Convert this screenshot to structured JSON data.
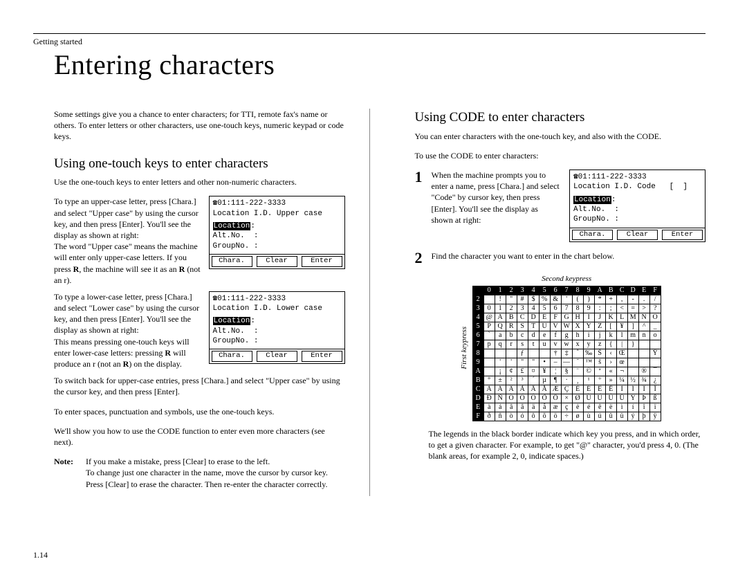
{
  "breadcrumb": "Getting started",
  "title": "Entering characters",
  "intro": "Some settings give you a chance to enter characters; for TTI, remote fax's name or others. To enter letters or other characters, use one-touch keys, numeric keypad or code keys.",
  "left": {
    "heading": "Using one-touch keys to enter characters",
    "p1": "Use the one-touch keys to enter letters and other non-numeric characters.",
    "p2": "To type an upper-case letter, press [Chara.] and select \"Upper case\" by using the cursor key, and then press [Enter]. You'll see the display as shown at right:",
    "p3a": "The word \"Upper case\" means the machine will enter only upper-case letters. If you press ",
    "p3b": "R",
    "p3c": ", the machine will see it as an ",
    "p3d": "R",
    "p3e": " (not an r).",
    "p4": "To type a lower-case letter, press [Chara.] and select \"Lower case\" by using the cursor key, and then press [Enter]. You'll see the display as shown at right:",
    "p5a": "This means pressing one-touch keys will enter lower-case letters: pressing ",
    "p5b": "R",
    "p5c": " will produce an r (not an ",
    "p5d": "R",
    "p5e": ") on the display.",
    "p6": "To switch back for upper-case entries, press [Chara.] and select \"Upper case\" by using the cursor key, and then press [Enter].",
    "p7": "To enter spaces, punctuation and symbols, use the one-touch keys.",
    "p8a": "We'll show you how to use the ",
    "p8b": "CODE",
    "p8c": " function to enter even more characters (see next).",
    "note_label": "Note:",
    "note_body": "If you make a mistake, press [Clear] to erase to the left.\nTo change just one character in the name, move the cursor by cursor key. Press [Clear] to erase the character. Then re-enter the character correctly."
  },
  "right": {
    "heading_a": "Using ",
    "heading_b": "CODE",
    "heading_c": " to enter characters",
    "p1a": "You can enter characters with the one-touch key, and also with the ",
    "p1b": "CODE",
    "p1c": ".",
    "p2a": "To use the ",
    "p2b": "CODE",
    "p2c": " to enter characters:",
    "step1": "When the machine prompts you to enter a name, press [Chara.] and select \"Code\" by cursor key, then press [Enter]. You'll see the display as shown at right:",
    "step2": "Find the character you want to enter in the chart below.",
    "chart_h": "Second keypress",
    "chart_v": "First keypress",
    "legend": "The legends in the black border indicate which key you press, and in which order, to get a given character. For example, to get \"@\" character, you'd press 4, 0. (The blank areas, for example 2, 0, indicate spaces.)"
  },
  "lcd": {
    "upper": {
      "l1": "☎01:111-222-3333",
      "l2": "Location I.D. Upper case",
      "l3_pre": "Location",
      "l3_post": ":",
      "l4": "Alt.No.  :",
      "l5": "GroupNo. :",
      "b1": "Chara.",
      "b2": "Clear",
      "b3": "Enter"
    },
    "lower": {
      "l1": "☎01:111-222-3333",
      "l2": "Location I.D. Lower case",
      "l3_pre": "Location",
      "l3_post": ":",
      "l4": "Alt.No.  :",
      "l5": "GroupNo. :",
      "b1": "Chara.",
      "b2": "Clear",
      "b3": "Enter"
    },
    "code": {
      "l1": "☎01:111-222-3333",
      "l2": "Location I.D. Code   [  ]",
      "l3_pre": "Location",
      "l3_post": ":",
      "l4": "Alt.No.  :",
      "l5": "GroupNo. :",
      "b1": "Chara.",
      "b2": "Clear",
      "b3": "Enter"
    }
  },
  "chart_data": {
    "type": "table",
    "col_headers": [
      "0",
      "1",
      "2",
      "3",
      "4",
      "5",
      "6",
      "7",
      "8",
      "9",
      "A",
      "B",
      "C",
      "D",
      "E",
      "F"
    ],
    "row_headers": [
      "2",
      "3",
      "4",
      "5",
      "6",
      "7",
      "8",
      "9",
      "A",
      "B",
      "C",
      "D",
      "E",
      "F"
    ],
    "rows": [
      [
        "",
        "!",
        "\"",
        "#",
        "$",
        "%",
        "&",
        "'",
        "(",
        ")",
        "*",
        "+",
        ",",
        "-",
        ".",
        "/"
      ],
      [
        "0",
        "1",
        "2",
        "3",
        "4",
        "5",
        "6",
        "7",
        "8",
        "9",
        ":",
        ";",
        "<",
        "=",
        ">",
        "?"
      ],
      [
        "@",
        "A",
        "B",
        "C",
        "D",
        "E",
        "F",
        "G",
        "H",
        "I",
        "J",
        "K",
        "L",
        "M",
        "N",
        "O"
      ],
      [
        "P",
        "Q",
        "R",
        "S",
        "T",
        "U",
        "V",
        "W",
        "X",
        "Y",
        "Z",
        "[",
        "¥",
        "]",
        "^",
        "_"
      ],
      [
        "`",
        "a",
        "b",
        "c",
        "d",
        "e",
        "f",
        "g",
        "h",
        "i",
        "j",
        "k",
        "l",
        "m",
        "n",
        "o"
      ],
      [
        "p",
        "q",
        "r",
        "s",
        "t",
        "u",
        "v",
        "w",
        "x",
        "y",
        "z",
        "{",
        "|",
        "}",
        "‾",
        ""
      ],
      [
        "",
        "",
        "",
        "ƒ",
        "",
        "",
        "†",
        "‡",
        "ˆ",
        "‰",
        "Š",
        "‹",
        "Œ",
        "",
        "",
        "Ÿ"
      ],
      [
        "",
        "'",
        "'",
        "\"",
        "\"",
        "•",
        "–",
        "—",
        "˜",
        "™",
        "š",
        "›",
        "œ",
        "",
        "",
        ""
      ],
      [
        "",
        "¡",
        "¢",
        "£",
        "¤",
        "¥",
        "¦",
        "§",
        "¨",
        "©",
        "ª",
        "«",
        "¬",
        "­",
        "®",
        "¯"
      ],
      [
        "°",
        "±",
        "²",
        "³",
        "´",
        "µ",
        "¶",
        "·",
        "¸",
        "¹",
        "º",
        "»",
        "¼",
        "½",
        "¾",
        "¿"
      ],
      [
        "À",
        "Á",
        "Â",
        "Ã",
        "Ä",
        "Å",
        "Æ",
        "Ç",
        "È",
        "É",
        "Ê",
        "Ë",
        "Ì",
        "Í",
        "Î",
        "Ï"
      ],
      [
        "Đ",
        "Ñ",
        "Ò",
        "Ó",
        "Ô",
        "Õ",
        "Ö",
        "×",
        "Ø",
        "Ù",
        "Ú",
        "Û",
        "Ü",
        "Ý",
        "Þ",
        "ß"
      ],
      [
        "à",
        "á",
        "â",
        "ã",
        "ä",
        "å",
        "æ",
        "ç",
        "è",
        "é",
        "ê",
        "ë",
        "ì",
        "í",
        "î",
        "ï"
      ],
      [
        "ð",
        "ñ",
        "ò",
        "ó",
        "ô",
        "õ",
        "ö",
        "÷",
        "ø",
        "ù",
        "ú",
        "û",
        "ü",
        "ý",
        "þ",
        "ÿ"
      ]
    ]
  },
  "page_number": "1.14"
}
